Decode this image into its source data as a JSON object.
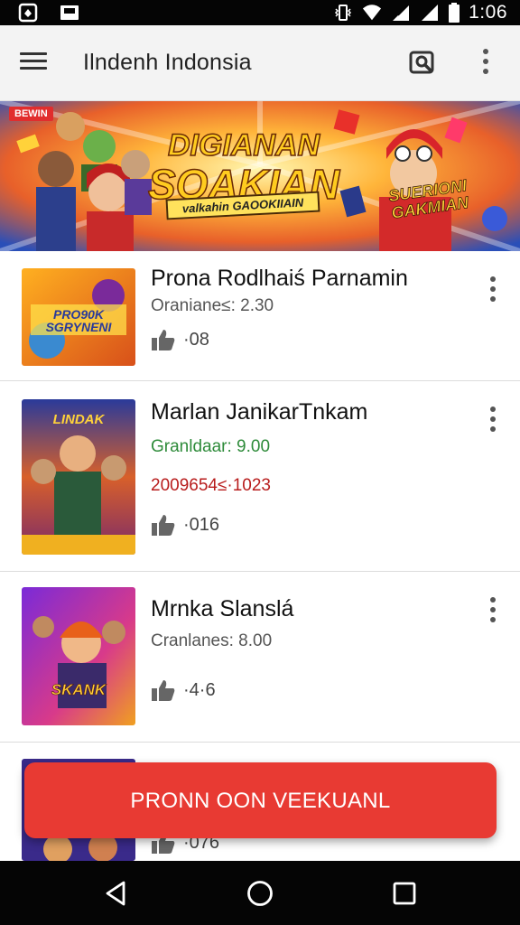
{
  "status_bar": {
    "time": "1:06",
    "icons": [
      "app-notification-icon",
      "image-notification-icon",
      "vibrate-icon",
      "wifi-icon",
      "signal-icon",
      "signal-icon",
      "battery-icon"
    ]
  },
  "app_bar": {
    "title": "Ilndenh Indonsia",
    "icons": [
      "menu-icon",
      "search-icon",
      "more-vert-icon"
    ]
  },
  "banner": {
    "badge": "BEWIN",
    "title_line1": "DIGIANAN",
    "title_line2": "SOAKIAN",
    "subtitle": "valkahin GAOOKIIAIN",
    "side_text": "SUERIONI GAKMIAN"
  },
  "items": [
    {
      "title": "Prona Rodlhaiś Parnamin",
      "meta": [
        "Oraniane≤: 2.30"
      ],
      "likes": "·08",
      "thumb_text": "PRO90K SGRYNENI"
    },
    {
      "title": "Marlan JanikarTnkam",
      "meta": [
        "Granldaar: 9.00",
        "2009654≤·1023"
      ],
      "likes": "·016",
      "thumb_text": "LINDAK"
    },
    {
      "title": "Mrnka Slanslá",
      "meta": [
        "Cranlanes: 8.00"
      ],
      "likes": "·4·6",
      "thumb_text": "SKANK"
    },
    {
      "title": "",
      "meta": [],
      "likes": "·076",
      "thumb_text": ""
    }
  ],
  "cta": {
    "label": "PRONN OON VEEKUANL"
  },
  "nav_bar": {
    "icons": [
      "back-icon",
      "home-icon",
      "recents-icon"
    ]
  },
  "colors": {
    "accent": "#e83a33",
    "status_bar": "#050505",
    "app_bar": "#f3f3f3",
    "meta_green": "#2e8b3a",
    "meta_red": "#b81c1c"
  }
}
